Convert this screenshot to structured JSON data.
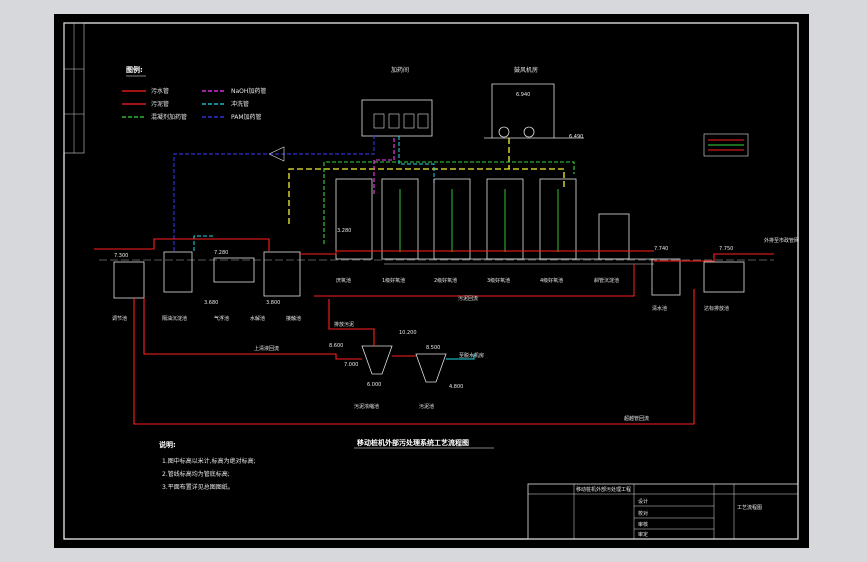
{
  "drawing": {
    "title": "移动桩机外部污处理系统工艺流程图",
    "legend_title": "图例:",
    "legend": [
      {
        "label": "污水管",
        "color": "#ff2020",
        "dash": "solid"
      },
      {
        "label": "污泥管",
        "color": "#ff2020",
        "dash": "solid"
      },
      {
        "label": "混凝剂加药管",
        "color": "#39d639",
        "dash": "dashed"
      },
      {
        "label": "NaOH加药管",
        "color": "#ff3cff",
        "dash": "dashed"
      },
      {
        "label": "冲洗管",
        "color": "#22d8e8",
        "dash": "dashed"
      },
      {
        "label": "PAM加药管",
        "color": "#3a3aff",
        "dash": "dashed"
      }
    ],
    "notes_title": "说明:",
    "notes": [
      "1.图中标高以米计,标高为绝对标高;",
      "2.管线标高均为管底标高;",
      "3.平面布置详见总图图纸。"
    ],
    "building_labels": {
      "dosing_room": "加药间",
      "blower_room": "鼓风机房"
    },
    "units": [
      "调节池",
      "隔油沉淀池",
      "气浮池",
      "水解池",
      "接触池",
      "厌氧池",
      "1级好氧池",
      "2级好氧池",
      "3级好氧池",
      "4级好氧池",
      "斜管沉淀池",
      "清水池",
      "达标排放池",
      "污泥浓缩池",
      "污泥池"
    ],
    "pipe_labels": {
      "return_sludge": "上清液回流",
      "sludge_return": "污泥回流",
      "drain": "排放污泥",
      "to_dewater": "至脱水机房",
      "outfall": "外排至市政管网",
      "overflow": "超越管回流"
    },
    "elevations": [
      "10.200",
      "8.600",
      "7.000",
      "6.000",
      "8.500",
      "4.800",
      "7.300",
      "7.280",
      "3.680",
      "3.800",
      "7.750",
      "7.740",
      "6.490",
      "6.940",
      "3.280"
    ],
    "title_block": {
      "project": "移动桩机外部污处理工程",
      "drawing_name": "工艺流程图",
      "rows": [
        "设计",
        "校对",
        "审核",
        "审定"
      ]
    }
  }
}
